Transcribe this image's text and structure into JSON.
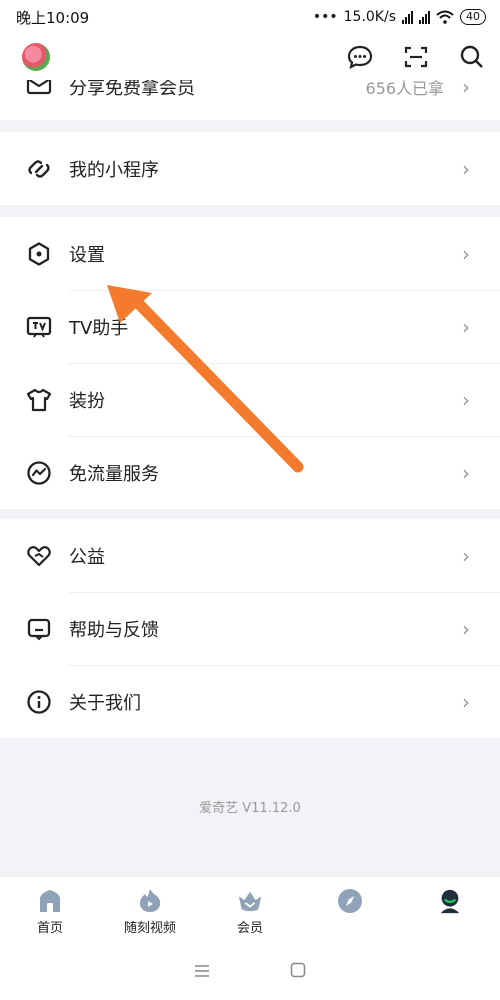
{
  "status_bar": {
    "time": "晚上10:09",
    "speed": "15.0K/s",
    "battery": "40"
  },
  "header": {
    "icons": [
      "message-icon",
      "scan-icon",
      "search-icon"
    ]
  },
  "peek_item": {
    "label": "分享免费拿会员",
    "right_text": "656人已拿"
  },
  "groups": [
    {
      "items": [
        {
          "label": "我的小程序",
          "icon": "mini-program-icon"
        }
      ]
    },
    {
      "items": [
        {
          "label": "设置",
          "icon": "settings-icon"
        },
        {
          "label": "TV助手",
          "icon": "tv-icon"
        },
        {
          "label": "装扮",
          "icon": "shirt-icon"
        },
        {
          "label": "免流量服务",
          "icon": "free-data-icon"
        }
      ]
    },
    {
      "items": [
        {
          "label": "公益",
          "icon": "charity-icon"
        },
        {
          "label": "帮助与反馈",
          "icon": "help-icon"
        },
        {
          "label": "关于我们",
          "icon": "info-icon"
        }
      ]
    }
  ],
  "chevron": "›",
  "version": "爱奇艺 V11.12.0",
  "tabs": [
    {
      "label": "首页",
      "icon": "home-icon"
    },
    {
      "label": "随刻视频",
      "icon": "video-flame-icon"
    },
    {
      "label": "会员",
      "icon": "vip-crown-icon"
    },
    {
      "label": "",
      "icon": "compass-icon"
    },
    {
      "label": "",
      "icon": "profile-icon"
    }
  ],
  "accent_color": "#f47a2e"
}
